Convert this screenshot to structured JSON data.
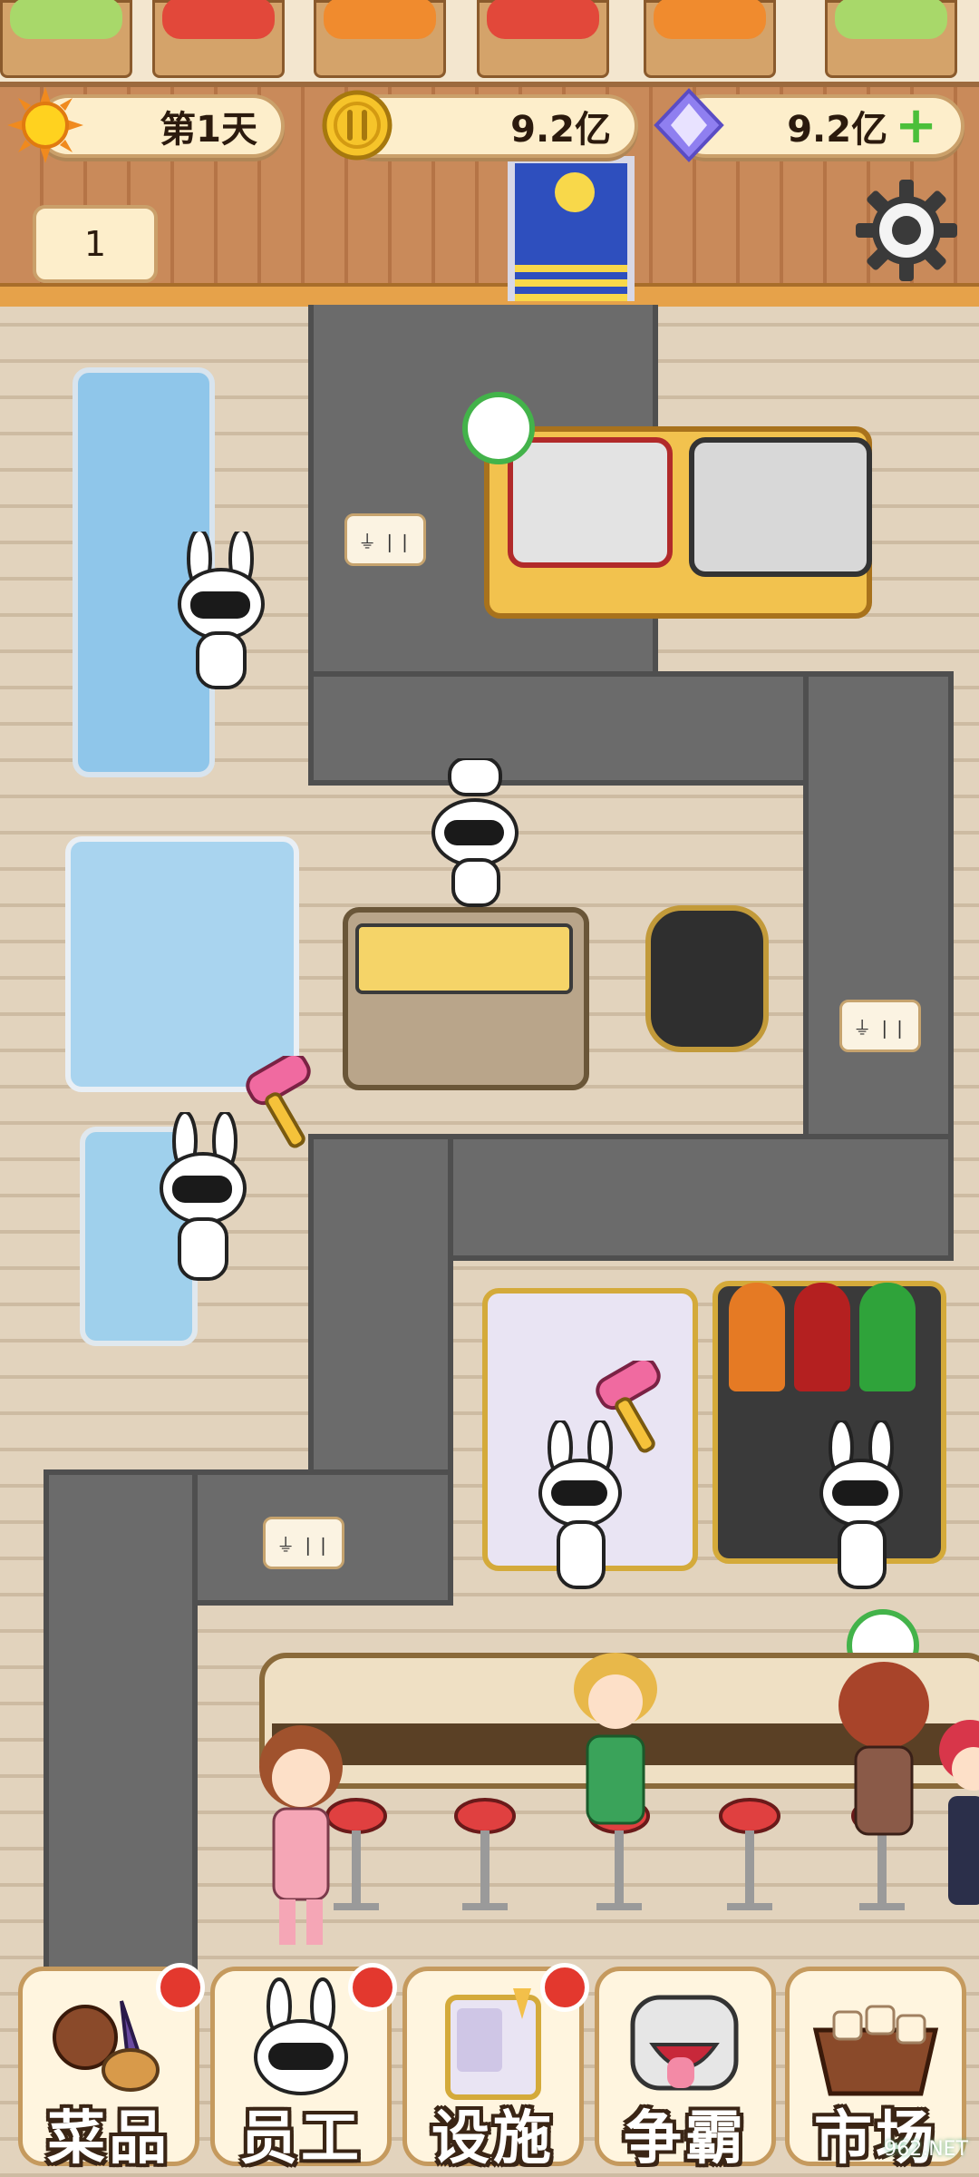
{
  "hud": {
    "day_label": "第1天",
    "coins": "9.2亿",
    "gems": "9.2亿",
    "gems_add": "+",
    "level_value": "1"
  },
  "nav": {
    "items": [
      {
        "label": "菜品",
        "icon": "dish-icon",
        "has_badge": true
      },
      {
        "label": "员工",
        "icon": "staff-icon",
        "has_badge": true
      },
      {
        "label": "设施",
        "icon": "facility-icon",
        "has_badge": true
      },
      {
        "label": "争霸",
        "icon": "battle-icon",
        "has_badge": false
      },
      {
        "label": "市场",
        "icon": "market-icon",
        "has_badge": false
      }
    ]
  },
  "watermark": "962.NET",
  "colors": {
    "hud_pill_bg": "#fdeecb",
    "badge_red": "#e3382e",
    "path_gray": "#6b6b6b",
    "plus_green": "#4bbf3a"
  }
}
